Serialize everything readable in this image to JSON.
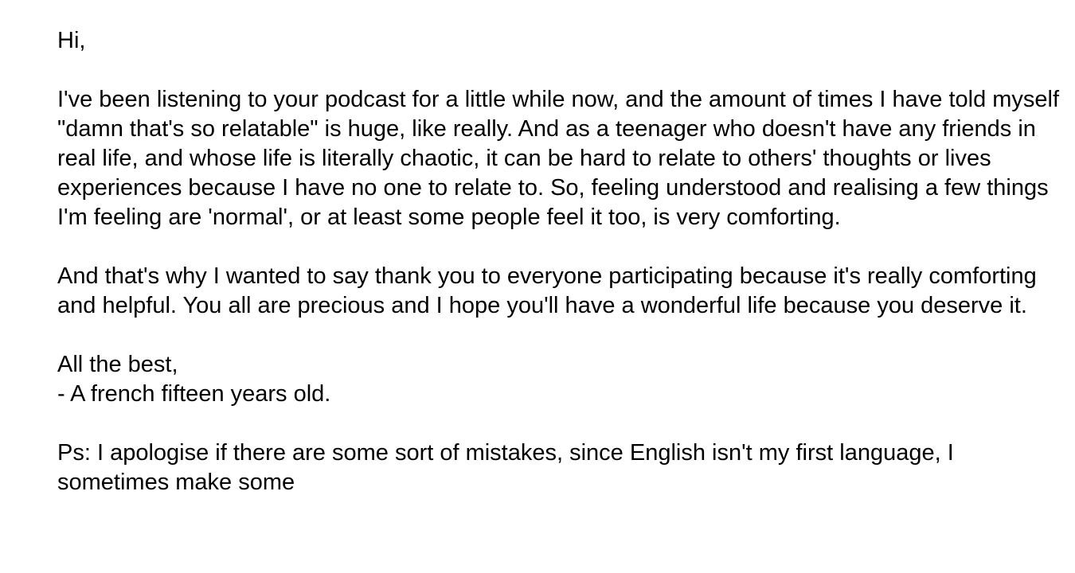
{
  "letter": {
    "greeting": "Hi,",
    "paragraph_1": "I've been listening to your podcast for a little while now, and the amount of times I have told myself \"damn that's so relatable\" is huge, like really. And as a teenager who doesn't have any friends in real life, and whose life is literally chaotic, it can be hard to relate to others' thoughts or lives experiences because I have no one to relate to. So, feeling understood and realising a few things I'm feeling are 'normal', or at least some people feel it too, is very comforting.",
    "paragraph_2": "And that's why I wanted to say thank you to everyone participating because it's really comforting and helpful. You all are precious and I hope you'll have a wonderful life because you deserve it.",
    "closing": "All the best,",
    "signature": "- A french fifteen years old.",
    "postscript": "Ps: I apologise if there are some sort of mistakes, since English isn't my first language, I sometimes make some"
  }
}
